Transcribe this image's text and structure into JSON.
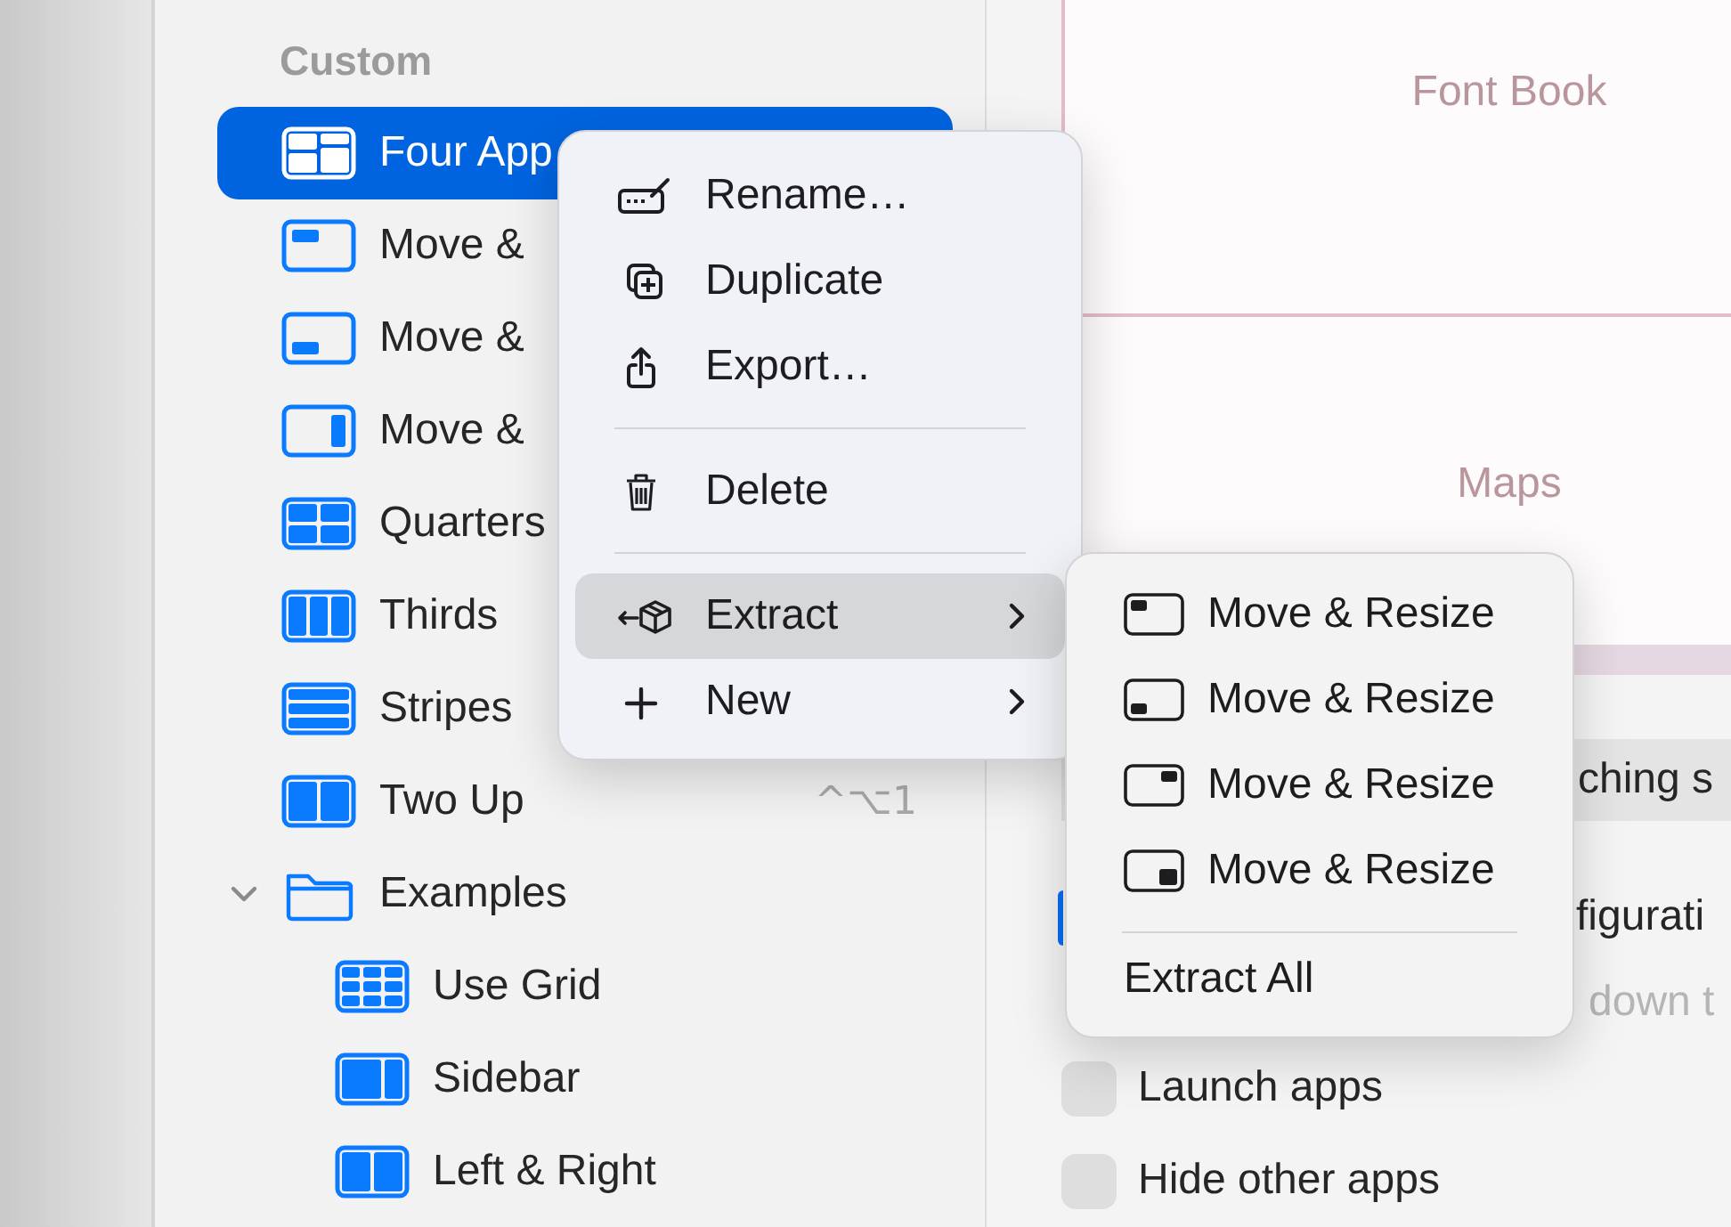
{
  "sidebar": {
    "section_title": "Custom",
    "items": [
      {
        "label": "Four App",
        "kind": "quad",
        "selected": true
      },
      {
        "label": "Move &",
        "kind": "topleft",
        "selected": false
      },
      {
        "label": "Move &",
        "kind": "bottomleft",
        "selected": false
      },
      {
        "label": "Move &",
        "kind": "right",
        "selected": false
      },
      {
        "label": "Quarters",
        "kind": "quarters",
        "selected": false
      },
      {
        "label": "Thirds",
        "kind": "thirds",
        "selected": false
      },
      {
        "label": "Stripes",
        "kind": "stripes",
        "selected": false
      },
      {
        "label": "Two Up",
        "kind": "twoup",
        "selected": false,
        "shortcut": "^⌥1"
      },
      {
        "label": "Examples",
        "kind": "folder",
        "selected": false,
        "expanded": true,
        "children": [
          {
            "label": "Use Grid",
            "kind": "grid",
            "selected": false
          },
          {
            "label": "Sidebar",
            "kind": "sidebar",
            "selected": false
          },
          {
            "label": "Left & Right",
            "kind": "twoup",
            "selected": false
          }
        ]
      }
    ]
  },
  "preview": {
    "tiles": [
      {
        "label": "Font Book"
      },
      {
        "label": "Maps"
      }
    ]
  },
  "settings": {
    "rows": [
      {
        "kind": "highlight",
        "text": "ching s"
      },
      {
        "kind": "covered",
        "text": "figurati",
        "checked": true
      },
      {
        "kind": "hint",
        "text": "down t"
      },
      {
        "kind": "checkbox",
        "text": "Launch apps",
        "checked": false
      },
      {
        "kind": "checkbox",
        "text": "Hide other apps",
        "checked": false
      }
    ]
  },
  "context_menu": {
    "items": [
      {
        "kind": "rename",
        "label": "Rename…",
        "selected": false
      },
      {
        "kind": "duplicate",
        "label": "Duplicate",
        "selected": false
      },
      {
        "kind": "export",
        "label": "Export…",
        "selected": false
      },
      {
        "kind": "separator"
      },
      {
        "kind": "delete",
        "label": "Delete",
        "selected": false
      },
      {
        "kind": "separator"
      },
      {
        "kind": "extract",
        "label": "Extract",
        "selected": true,
        "submenu": true
      },
      {
        "kind": "new",
        "label": "New",
        "selected": false,
        "submenu": true
      }
    ]
  },
  "submenu": {
    "items": [
      {
        "kind": "topleft",
        "label": "Move & Resize"
      },
      {
        "kind": "bottomleft",
        "label": "Move & Resize"
      },
      {
        "kind": "topright",
        "label": "Move & Resize"
      },
      {
        "kind": "bottomright",
        "label": "Move & Resize"
      },
      {
        "kind": "separator"
      },
      {
        "kind": "plain",
        "label": "Extract All"
      }
    ]
  }
}
